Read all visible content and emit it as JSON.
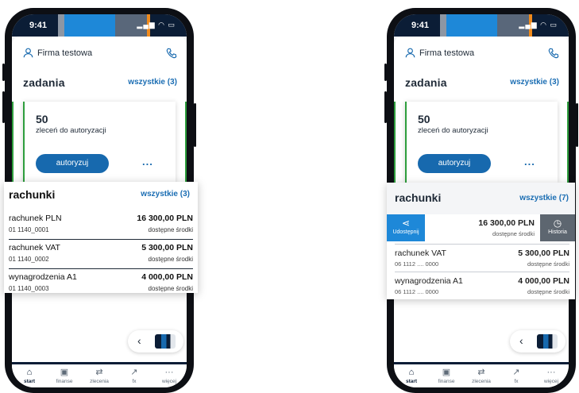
{
  "status_time": "9:41",
  "company_name": "Firma testowa",
  "tasks": {
    "title": "zadania",
    "all_label": "wszystkie (3)",
    "count": "50",
    "description": "zleceń do autoryzacji",
    "authorize_label": "autoryzuj",
    "more_label": "..."
  },
  "tabs": [
    {
      "label": "start",
      "icon": "home-icon"
    },
    {
      "label": "finanse",
      "icon": "wallet-icon"
    },
    {
      "label": "zlecenia",
      "icon": "transfer-icon"
    },
    {
      "label": "fx",
      "icon": "fx-chart-icon"
    },
    {
      "label": "więcej",
      "icon": "more-icon"
    }
  ],
  "accounts_left": {
    "title": "rachunki",
    "all_label": "wszystkie (3)",
    "rows": [
      {
        "name": "rachunek PLN",
        "number": "01 1140_0001",
        "amount": "16 300,00 PLN",
        "available": "dostępne środki"
      },
      {
        "name": "rachunek VAT",
        "number": "01 1140_0002",
        "amount": "5 300,00 PLN",
        "available": "dostępne środki"
      },
      {
        "name": "wynagrodzenia A1",
        "number": "01 1140_0003",
        "amount": "4 000,00 PLN",
        "available": "dostępne środki"
      }
    ]
  },
  "accounts_right": {
    "title": "rachunki",
    "all_label": "wszystkie (7)",
    "share_label": "Udostępnij",
    "history_label": "Historia",
    "swiped_amount": "16 300,00 PLN",
    "swiped_available": "dostępne środki",
    "rows": [
      {
        "name": "rachunek VAT",
        "number": "06 1112 .... 0000",
        "amount": "5 300,00 PLN",
        "available": "dostępne środki"
      },
      {
        "name": "wynagrodzenia A1",
        "number": "06 1112 .... 0000",
        "amount": "4 000,00 PLN",
        "available": "dostępne środki"
      }
    ]
  },
  "colors": {
    "brand_navy": "#0b1d36",
    "brand_blue": "#1769ae",
    "accent_green": "#2e9e3d",
    "share_blue": "#1e88d8",
    "history_gray": "#5d6670"
  }
}
